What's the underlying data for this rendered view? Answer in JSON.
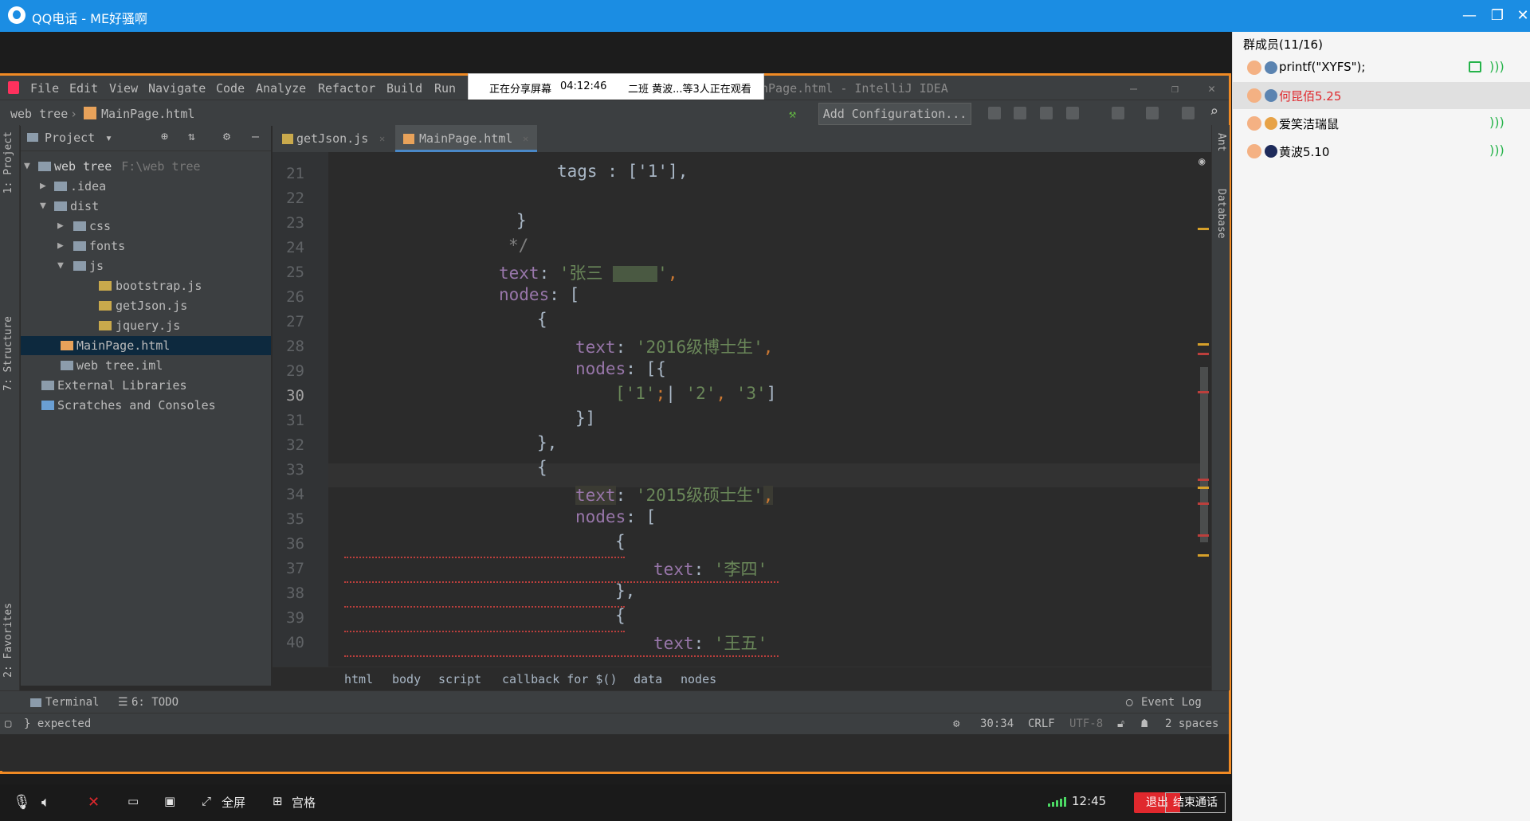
{
  "window": {
    "title": "QQ电话 - ME好骚啊"
  },
  "share_bar": {
    "status": "正在分享屏幕",
    "time": "04:12:46",
    "viewers": "二班 黄波...等3人正在观看"
  },
  "ide": {
    "menu": [
      "File",
      "Edit",
      "View",
      "Navigate",
      "Code",
      "Analyze",
      "Refactor",
      "Build",
      "Run"
    ],
    "title_suffix": "nPage.html - IntelliJ IDEA",
    "nav": {
      "project": "web tree",
      "file": "MainPage.html",
      "add_config": "Add Configuration..."
    },
    "project_panel": {
      "header": "Project",
      "tree": [
        {
          "label": "web tree",
          "path": "F:\\web tree"
        },
        {
          "label": ".idea"
        },
        {
          "label": "dist"
        },
        {
          "label": "css"
        },
        {
          "label": "fonts"
        },
        {
          "label": "js"
        },
        {
          "label": "bootstrap.js"
        },
        {
          "label": "getJson.js"
        },
        {
          "label": "jquery.js"
        },
        {
          "label": "MainPage.html"
        },
        {
          "label": "web tree.iml"
        },
        {
          "label": "External Libraries"
        },
        {
          "label": "Scratches and Consoles"
        }
      ]
    },
    "left_tool_labels": [
      "1: Project",
      "7: Structure",
      "2: Favorites"
    ],
    "right_tool_labels": [
      "Ant",
      "Database"
    ],
    "tabs": [
      "getJson.js",
      "MainPage.html"
    ],
    "line_numbers": [
      "21",
      "22",
      "23",
      "24",
      "25",
      "26",
      "27",
      "28",
      "29",
      "30",
      "31",
      "32",
      "33",
      "34",
      "35",
      "36",
      "37",
      "38",
      "39",
      "40"
    ],
    "code": {
      "l21": "tags : ['1'],",
      "l23": "}",
      "l24": "*/",
      "l25_key": "text",
      "l25_val": "'张三 ",
      "l25_end": "'",
      "l26_key": "nodes",
      "l26_rest": ": [",
      "l27": "{",
      "l28_key": "text",
      "l28_val": "'2016级博士生'",
      "l29_key": "nodes",
      "l29_rest": ": [{",
      "l30_a": "['1'",
      "l30_b": "'2'",
      "l30_c": "'3'",
      "l30_end": "]",
      "l31": "}]",
      "l32": "},",
      "l33": "{",
      "l34_key": "text",
      "l34_val": "'2015级硕士生'",
      "l35_key": "nodes",
      "l35_rest": ": [",
      "l36": "{",
      "l37_key": "text",
      "l37_val": "'李四'",
      "l38": "},",
      "l39": "{",
      "l40_key": "text",
      "l40_val": "'王五'"
    },
    "breadcrumbs": [
      "html",
      "body",
      "script",
      "callback for $()",
      "data",
      "nodes"
    ],
    "tool_windows": {
      "terminal": "Terminal",
      "todo": "6: TODO",
      "event_log": "Event Log"
    },
    "status": {
      "message": "} expected",
      "position": "30:34",
      "line_sep": "CRLF",
      "encoding": "UTF-8",
      "indent": "2 spaces"
    }
  },
  "members": {
    "header": "群成员(11/16)",
    "list": [
      {
        "name": "printf(\"XYFS\");"
      },
      {
        "name": "何昆佰5.25",
        "color": "#e0282d"
      },
      {
        "name": "爱笑洁瑞鼠"
      },
      {
        "name": "黄波5.10"
      }
    ]
  },
  "bottom": {
    "fullscreen": "全屏",
    "grid": "宫格",
    "clock": "12:45",
    "exit": "退出",
    "end_call": "结束通话"
  },
  "colors": {
    "qq_blue": "#1b8de3",
    "share_border": "#f08a24",
    "exit_red": "#e0282d"
  }
}
